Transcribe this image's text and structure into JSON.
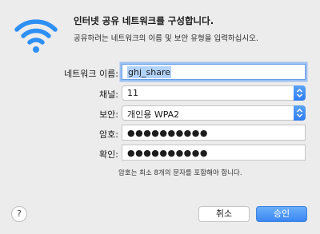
{
  "dialog": {
    "title": "인터넷 공유 네트워크를 구성합니다.",
    "subtitle": "공유하려는 네트워크의 이름 및 보안 유형을 입력하십시오.",
    "icon": "wifi-icon"
  },
  "form": {
    "network_name_label": "네트워크 이름:",
    "network_name_value": "ghj_share",
    "channel_label": "채널:",
    "channel_value": "11",
    "security_label": "보안:",
    "security_value": "개인용 WPA2",
    "password_label": "암호:",
    "password_value": "●●●●●●●●●●",
    "confirm_label": "확인:",
    "confirm_value": "●●●●●●●●●●",
    "hint": "암호는 최소 8개의 문자를 포함해야 합니다."
  },
  "buttons": {
    "help": "?",
    "cancel": "취소",
    "ok": "승인"
  },
  "colors": {
    "accent": "#3b87f3",
    "wifi_icon": "#2e8ff5",
    "selection": "#b3d3fd"
  }
}
